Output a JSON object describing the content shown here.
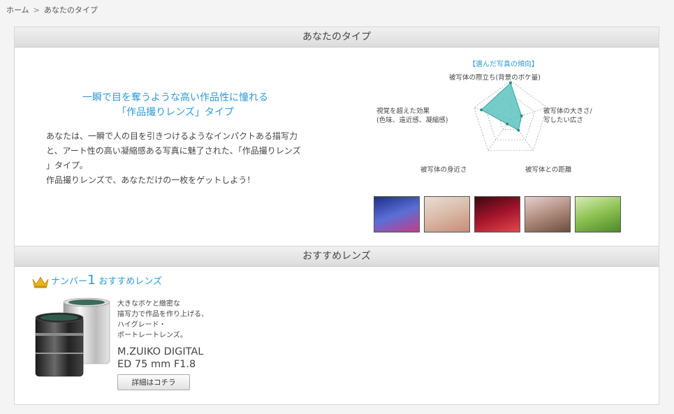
{
  "breadcrumb": {
    "home": "ホーム",
    "separator": ">",
    "current": "あなたのタイプ"
  },
  "type_section": {
    "heading": "あなたのタイプ",
    "title_line1": "一瞬で目を奪うような高い作品性に憧れる",
    "title_line2": "「作品撮りレンズ」タイプ",
    "desc_line1": "あなたは、一瞬で人の目を引きつけるようなインパクトある描写力",
    "desc_line2": "と、アート性の高い凝縮感ある写真に魅了された、「作品撮りレンズ",
    "desc_line3": "」タイプ。",
    "desc_line4": "作品撮りレンズで、あなただけの一枚をゲットしよう！"
  },
  "radar": {
    "heading": "【選んだ写真の傾向】",
    "axes": [
      {
        "label_line1": "被写体の際立ち(背景のボケ量)",
        "label_line2": "",
        "value": 0.95
      },
      {
        "label_line1": "被写体の大きさ/",
        "label_line2": "写したい広さ",
        "value": 0.3
      },
      {
        "label_line1": "被写体との距離",
        "label_line2": "",
        "value": 0.35
      },
      {
        "label_line1": "被写体の身近さ",
        "label_line2": "",
        "value": 0.15
      },
      {
        "label_line1": "視覚を超えた効果",
        "label_line2": "(色味、遠近感、凝縮感)",
        "value": 0.8
      }
    ],
    "fill_color": "#5ec3c0",
    "stroke_color": "#3aa5a2"
  },
  "thumbnails": [
    {
      "name": "sunset-sea-thumbnail",
      "colors": [
        "#1d2f8a",
        "#5a6fd6",
        "#c43c8a"
      ]
    },
    {
      "name": "pampas-grass-thumbnail",
      "colors": [
        "#e9ddd2",
        "#d9b9a6",
        "#c88b78"
      ]
    },
    {
      "name": "raindrop-bokeh-thumbnail",
      "colors": [
        "#3a0a10",
        "#a3132a",
        "#e2484c"
      ]
    },
    {
      "name": "squirrel-blossom-thumbnail",
      "colors": [
        "#e8cfd0",
        "#b08c7e",
        "#6b4e3d"
      ]
    },
    {
      "name": "green-leaves-thumbnail",
      "colors": [
        "#d9ecb5",
        "#8cc152",
        "#4d8a2b"
      ]
    }
  ],
  "recommend_section": {
    "heading": "おすすめレンズ",
    "rank_prefix": "ナンバー",
    "rank_number": "1",
    "rank_suffix": " おすすめレンズ",
    "desc_line1": "大きなボケと緻密な",
    "desc_line2": "描写力で作品を作り上げる、",
    "desc_line3": "ハイグレード・",
    "desc_line4": "ポートレートレンズ。",
    "lens_name_line1": "M.ZUIKO DIGITAL",
    "lens_name_line2": "ED 75 mm F1.8",
    "detail_button": "詳細はコチラ"
  },
  "colors": {
    "accent": "#2e9ad7",
    "crown": "#e8b21a"
  }
}
